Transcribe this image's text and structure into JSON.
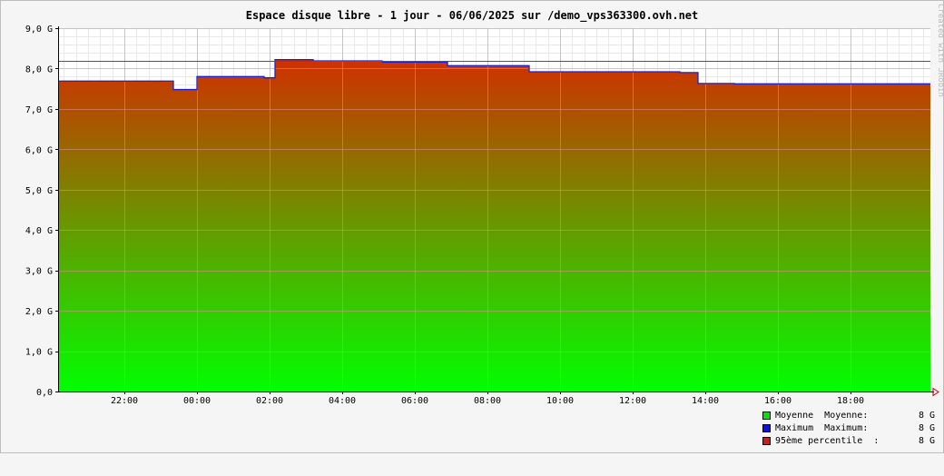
{
  "chart_data": {
    "type": "area",
    "title": "Espace disque libre - 1 jour - 06/06/2025 sur /demo_vps363300.ovh.net",
    "watermark": "Created with JRobin",
    "xlabel": "",
    "ylabel": "",
    "x_tick_labels": [
      "22:00",
      "00:00",
      "02:00",
      "04:00",
      "06:00",
      "08:00",
      "10:00",
      "12:00",
      "14:00",
      "16:00",
      "18:00"
    ],
    "x_tick_hours": [
      -2,
      0,
      2,
      4,
      6,
      8,
      10,
      12,
      14,
      16,
      18
    ],
    "xlim_hours": [
      -3.8,
      20.2
    ],
    "y_tick_labels": [
      "0,0",
      "1,0 G",
      "2,0 G",
      "3,0 G",
      "4,0 G",
      "5,0 G",
      "6,0 G",
      "7,0 G",
      "8,0 G",
      "9,0 G"
    ],
    "ylim": [
      0,
      9
    ],
    "grid": true,
    "percentile_95": 8.2,
    "series": [
      {
        "name": "Moyenne",
        "x_hours": [
          -3.8,
          -0.65,
          -0.65,
          0.0,
          0.0,
          1.85,
          1.85,
          2.15,
          2.15,
          3.2,
          3.2,
          5.1,
          5.1,
          6.9,
          6.9,
          9.15,
          9.15,
          13.3,
          13.3,
          13.8,
          13.8,
          14.8,
          14.8,
          20.2
        ],
        "y": [
          7.69,
          7.69,
          7.48,
          7.48,
          7.8,
          7.8,
          7.77,
          7.77,
          8.22,
          8.22,
          8.19,
          8.19,
          8.16,
          8.16,
          8.07,
          8.07,
          7.92,
          7.92,
          7.9,
          7.9,
          7.63,
          7.63,
          7.62,
          7.62
        ]
      }
    ],
    "legend": [
      {
        "label": "Moyenne  Moyenne:",
        "value": "8 G",
        "color": "#11dd11"
      },
      {
        "label": "Maximum  Maximum:",
        "value": "8 G",
        "color": "#1111dd"
      },
      {
        "label": "95ème percentile  :",
        "value": "8 G",
        "color": "#c02020"
      }
    ],
    "colors": {
      "area_top": "#d03000",
      "area_bottom": "#00ff00",
      "max_line": "#2020c8",
      "percentile_line": "#d02020",
      "grid_major": "#e09090",
      "grid_minor": "#e8e8e8"
    }
  }
}
